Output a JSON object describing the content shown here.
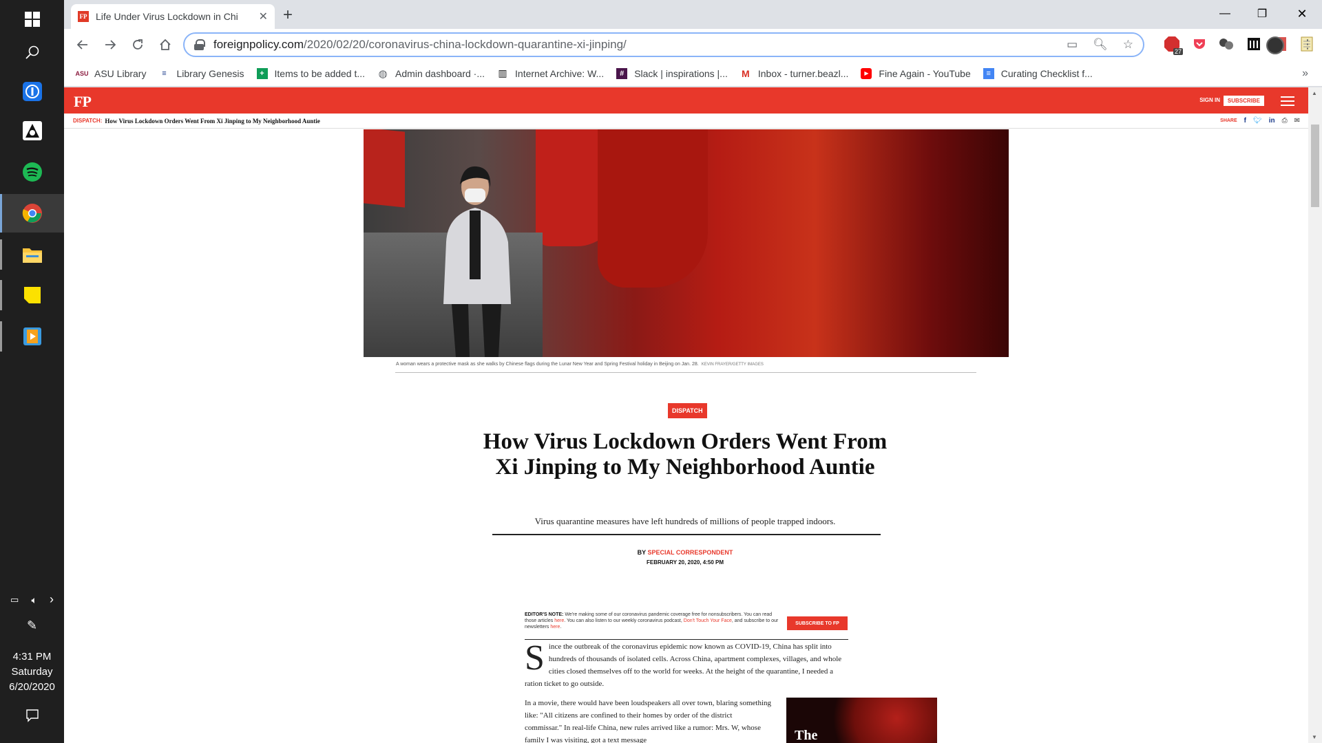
{
  "taskbar": {
    "apps": [
      "start",
      "search",
      "1password",
      "inkscape",
      "spotify",
      "chrome",
      "file-explorer",
      "sticky-notes",
      "media-player"
    ],
    "clock": {
      "time": "4:31 PM",
      "day": "Saturday",
      "date": "6/20/2020"
    }
  },
  "browser": {
    "tab_title": "Life Under Virus Lockdown in Chi",
    "url_host": "foreignpolicy.com",
    "url_path": "/2020/02/20/coronavirus-china-lockdown-quarantine-xi-jinping/",
    "extension_badge": "27",
    "bookmarks": [
      {
        "label": "ASU Library",
        "icon": "asu-icon"
      },
      {
        "label": "Library Genesis",
        "icon": "libgen-icon"
      },
      {
        "label": "Items to be added t...",
        "icon": "sheets-icon"
      },
      {
        "label": "Admin dashboard ·...",
        "icon": "globe-icon"
      },
      {
        "label": "Internet Archive: W...",
        "icon": "archive-icon"
      },
      {
        "label": "Slack | inspirations |...",
        "icon": "slack-icon"
      },
      {
        "label": "Inbox - turner.beazl...",
        "icon": "gmail-icon"
      },
      {
        "label": "Fine Again - YouTube",
        "icon": "youtube-icon"
      },
      {
        "label": "Curating Checklist f...",
        "icon": "docs-icon"
      }
    ]
  },
  "site": {
    "logo": "FP",
    "sign_in": "SIGN IN",
    "subscribe": "SUBSCRIBE",
    "kicker": "DISPATCH:",
    "sticky_headline": "How Virus Lockdown Orders Went From Xi Jinping to My Neighborhood Auntie",
    "share_label": "SHARE"
  },
  "article": {
    "caption": "A woman wears a protective mask as she walks by Chinese flags during the Lunar New Year and Spring Festival holiday in Beijing on Jan. 28.",
    "credit": "KEVIN FRAYER/GETTY IMAGES",
    "tag": "DISPATCH",
    "headline": "How Virus Lockdown Orders Went From Xi Jinping to My Neighborhood Auntie",
    "dek": "Virus quarantine measures have left hundreds of millions of people trapped indoors.",
    "by": "BY",
    "author": "SPECIAL CORRESPONDENT",
    "date": "FEBRUARY 20, 2020, 4:50 PM",
    "editors_note": {
      "label": "EDITOR'S NOTE:",
      "text1": "We're making some of our coronavirus pandemic coverage free for nonsubscribers. You can read those articles",
      "here1": "here",
      "text2": ". You can also listen to our weekly coronavirus podcast,",
      "podcast": "Don't Touch Your Face",
      "text3": ", and subscribe to our newsletters",
      "here2": "here",
      "text4": ".",
      "button": "SUBSCRIBE TO FP"
    },
    "dropcap": "S",
    "para1": "ince the outbreak of the coronavirus epidemic now known as COVID-19, China has split into hundreds of thousands of isolated cells. Across China, apartment complexes, villages, and whole cities closed themselves off to the world for weeks. At the height of the quarantine, I needed a ration ticket to go outside.",
    "para2": "In a movie, there would have been loudspeakers all over town, blaring something like: \"All citizens are confined to their homes by order of the district commissar.\" In real-life China, new rules arrived like a rumor: Mrs. W, whose family I was visiting, got a text message",
    "promo_title": "The"
  }
}
